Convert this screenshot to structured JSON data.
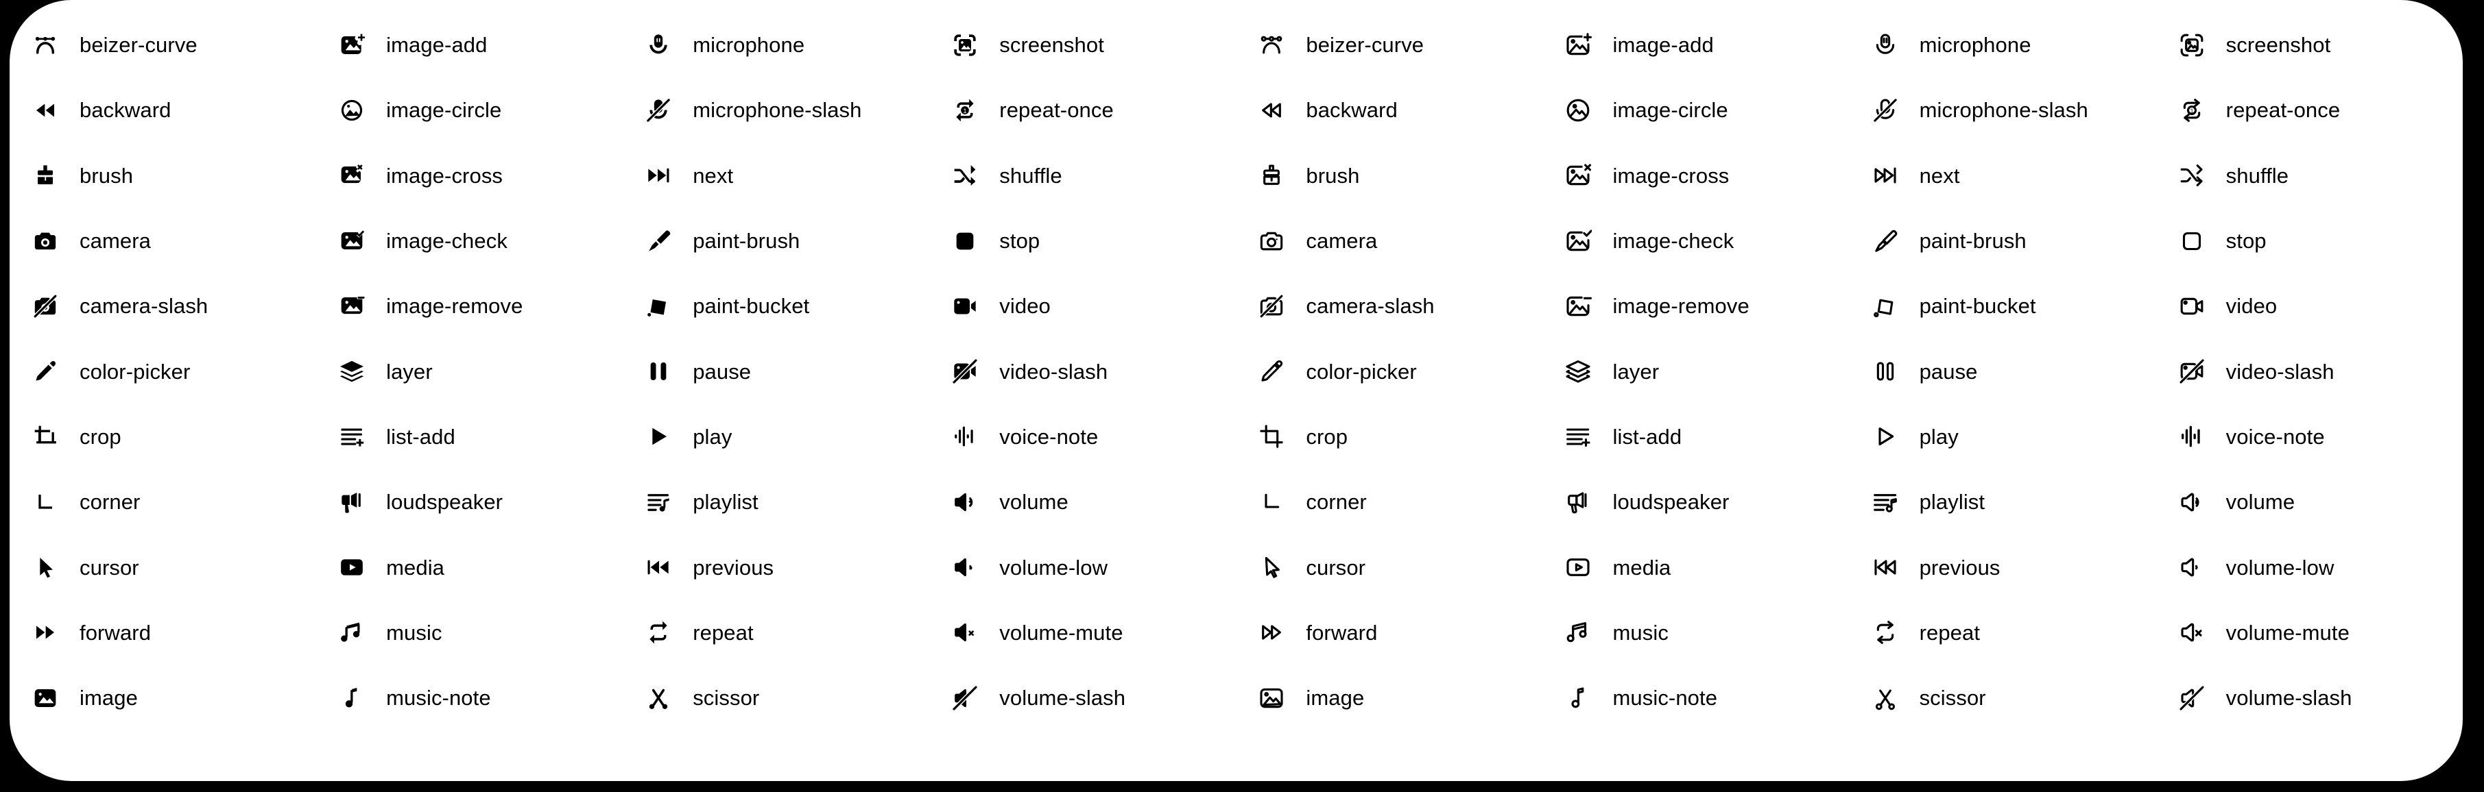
{
  "theme": {
    "page_background": "#000000",
    "card_background": "#ffffff",
    "icon_color": "#000000",
    "label_color": "#000000"
  },
  "sheet": {
    "columns": 8,
    "rows": 11,
    "styles": [
      "filled",
      "filled",
      "filled",
      "filled",
      "outline",
      "outline",
      "outline",
      "outline"
    ]
  },
  "icons": {
    "group_filled_1": [
      {
        "name": "beizer-curve",
        "label": "beizer-curve"
      },
      {
        "name": "backward",
        "label": "backward"
      },
      {
        "name": "brush",
        "label": "brush"
      },
      {
        "name": "camera",
        "label": "camera"
      },
      {
        "name": "camera-slash",
        "label": "camera-slash"
      },
      {
        "name": "color-picker",
        "label": "color-picker"
      },
      {
        "name": "crop",
        "label": "crop"
      },
      {
        "name": "corner",
        "label": "corner"
      },
      {
        "name": "cursor",
        "label": "cursor"
      },
      {
        "name": "forward",
        "label": "forward"
      },
      {
        "name": "image",
        "label": "image"
      }
    ],
    "group_filled_2": [
      {
        "name": "image-add",
        "label": "image-add"
      },
      {
        "name": "image-circle",
        "label": "image-circle"
      },
      {
        "name": "image-cross",
        "label": "image-cross"
      },
      {
        "name": "image-check",
        "label": "image-check"
      },
      {
        "name": "image-remove",
        "label": "image-remove"
      },
      {
        "name": "layer",
        "label": "layer"
      },
      {
        "name": "list-add",
        "label": "list-add"
      },
      {
        "name": "loudspeaker",
        "label": "loudspeaker"
      },
      {
        "name": "media",
        "label": "media"
      },
      {
        "name": "music",
        "label": "music"
      },
      {
        "name": "music-note",
        "label": "music-note"
      }
    ],
    "group_filled_3": [
      {
        "name": "microphone",
        "label": "microphone"
      },
      {
        "name": "microphone-slash",
        "label": "microphone-slash"
      },
      {
        "name": "next",
        "label": "next"
      },
      {
        "name": "paint-brush",
        "label": "paint-brush"
      },
      {
        "name": "paint-bucket",
        "label": "paint-bucket"
      },
      {
        "name": "pause",
        "label": "pause"
      },
      {
        "name": "play",
        "label": "play"
      },
      {
        "name": "playlist",
        "label": "playlist"
      },
      {
        "name": "previous",
        "label": "previous"
      },
      {
        "name": "repeat",
        "label": "repeat"
      },
      {
        "name": "scissor",
        "label": "scissor"
      }
    ],
    "group_filled_4": [
      {
        "name": "screenshot",
        "label": "screenshot"
      },
      {
        "name": "repeat-once",
        "label": "repeat-once"
      },
      {
        "name": "shuffle",
        "label": "shuffle"
      },
      {
        "name": "stop",
        "label": "stop"
      },
      {
        "name": "video",
        "label": "video"
      },
      {
        "name": "video-slash",
        "label": "video-slash"
      },
      {
        "name": "voice-note",
        "label": "voice-note"
      },
      {
        "name": "volume",
        "label": "volume"
      },
      {
        "name": "volume-low",
        "label": "volume-low"
      },
      {
        "name": "volume-mute",
        "label": "volume-mute"
      },
      {
        "name": "volume-slash",
        "label": "volume-slash"
      }
    ],
    "group_outline_1": [
      {
        "name": "beizer-curve",
        "label": "beizer-curve"
      },
      {
        "name": "backward",
        "label": "backward"
      },
      {
        "name": "brush",
        "label": "brush"
      },
      {
        "name": "camera",
        "label": "camera"
      },
      {
        "name": "camera-slash",
        "label": "camera-slash"
      },
      {
        "name": "color-picker",
        "label": "color-picker"
      },
      {
        "name": "crop",
        "label": "crop"
      },
      {
        "name": "corner",
        "label": "corner"
      },
      {
        "name": "cursor",
        "label": "cursor"
      },
      {
        "name": "forward",
        "label": "forward"
      },
      {
        "name": "image",
        "label": "image"
      }
    ],
    "group_outline_2": [
      {
        "name": "image-add",
        "label": "image-add"
      },
      {
        "name": "image-circle",
        "label": "image-circle"
      },
      {
        "name": "image-cross",
        "label": "image-cross"
      },
      {
        "name": "image-check",
        "label": "image-check"
      },
      {
        "name": "image-remove",
        "label": "image-remove"
      },
      {
        "name": "layer",
        "label": "layer"
      },
      {
        "name": "list-add",
        "label": "list-add"
      },
      {
        "name": "loudspeaker",
        "label": "loudspeaker"
      },
      {
        "name": "media",
        "label": "media"
      },
      {
        "name": "music",
        "label": "music"
      },
      {
        "name": "music-note",
        "label": "music-note"
      }
    ],
    "group_outline_3": [
      {
        "name": "microphone",
        "label": "microphone"
      },
      {
        "name": "microphone-slash",
        "label": "microphone-slash"
      },
      {
        "name": "next",
        "label": "next"
      },
      {
        "name": "paint-brush",
        "label": "paint-brush"
      },
      {
        "name": "paint-bucket",
        "label": "paint-bucket"
      },
      {
        "name": "pause",
        "label": "pause"
      },
      {
        "name": "play",
        "label": "play"
      },
      {
        "name": "playlist",
        "label": "playlist"
      },
      {
        "name": "previous",
        "label": "previous"
      },
      {
        "name": "repeat",
        "label": "repeat"
      },
      {
        "name": "scissor",
        "label": "scissor"
      }
    ],
    "group_outline_4": [
      {
        "name": "screenshot",
        "label": "screenshot"
      },
      {
        "name": "repeat-once",
        "label": "repeat-once"
      },
      {
        "name": "shuffle",
        "label": "shuffle"
      },
      {
        "name": "stop",
        "label": "stop"
      },
      {
        "name": "video",
        "label": "video"
      },
      {
        "name": "video-slash",
        "label": "video-slash"
      },
      {
        "name": "voice-note",
        "label": "voice-note"
      },
      {
        "name": "volume",
        "label": "volume"
      },
      {
        "name": "volume-low",
        "label": "volume-low"
      },
      {
        "name": "volume-mute",
        "label": "volume-mute"
      },
      {
        "name": "volume-slash",
        "label": "volume-slash"
      }
    ]
  },
  "badges": {
    "repeat_once_number": "1"
  }
}
